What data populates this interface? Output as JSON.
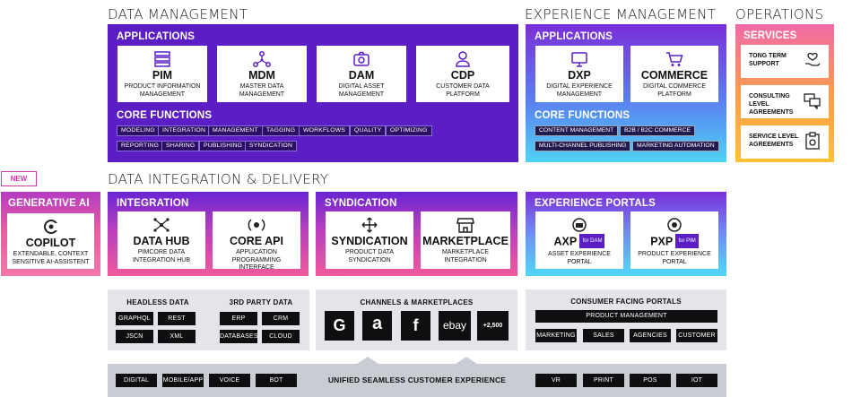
{
  "sections": {
    "data_management": "DATA MANAGEMENT",
    "experience_management": "EXPERIENCE MANAGEMENT",
    "operations": "OPERATIONS",
    "data_integration": "DATA INTEGRATION & DELIVERY"
  },
  "new_badge": "NEW",
  "dm": {
    "applications": "APPLICATIONS",
    "core_functions": "CORE FUNCTIONS",
    "apps": [
      {
        "title": "PIM",
        "sub": "PRODUCT INFORMATION MANAGEMENT",
        "icon": "server-stack-icon"
      },
      {
        "title": "MDM",
        "sub": "MASTER DATA MANAGEMENT",
        "icon": "network-icon"
      },
      {
        "title": "DAM",
        "sub": "DIGITAL ASSET MANAGEMENT",
        "icon": "camera-icon"
      },
      {
        "title": "CDP",
        "sub": "CUSTOMER DATA PLATFORM",
        "icon": "user-icon"
      }
    ],
    "functions": [
      "MODELING",
      "INTEGRATION",
      "MANAGEMENT",
      "TAGGING",
      "WORKFLOWS",
      "QUALITY",
      "OPTIMIZING",
      "REPORTING",
      "SHARING",
      "PUBLISHING",
      "SYNDICATION"
    ]
  },
  "xm": {
    "applications": "APPLICATIONS",
    "core_functions": "CORE FUNCTIONS",
    "apps": [
      {
        "title": "DXP",
        "sub": "DIGITAL EXPERIENCE MANAGEMENT",
        "icon": "monitor-icon"
      },
      {
        "title": "COMMERCE",
        "sub": "DIGITAL COMMERCE PLATFORM",
        "icon": "cart-icon"
      }
    ],
    "functions": [
      "CONTENT MANAGEMENT",
      "B2B / B2C COMMERCE",
      "MULTI-CHANNEL PUBLISHING",
      "MARKETING AUTOMATION"
    ]
  },
  "ops": {
    "services": "SERVICES",
    "cards": [
      {
        "label": "TONG TERM SUPPORT",
        "icon": "hand-heart-icon"
      },
      {
        "label": "CONSULTING LEVEL AGREEMENTS",
        "icon": "chat-icon"
      },
      {
        "label": "SERVICE LEVEL AGREEMENTS",
        "icon": "clipboard-icon"
      }
    ]
  },
  "genai": {
    "heading": "GENERATIVE AI",
    "title": "COPILOT",
    "sub": "EXTENDABLE, CONTEXT SENSITIVE AI-ASSISTENT"
  },
  "integration": {
    "heading": "INTEGRATION",
    "cards": [
      {
        "title": "DATA HUB",
        "sub": "PIMCORE DATA INTEGRATION HUB"
      },
      {
        "title": "CORE API",
        "sub": "APPLICATION PROGRAMMING INTERFACE"
      }
    ]
  },
  "syndication": {
    "heading": "SYNDICATION",
    "cards": [
      {
        "title": "SYNDICATION",
        "sub": "PRODUCT DATA SYNDICATION"
      },
      {
        "title": "MARKETPLACE",
        "sub": "MARKETPLACE INTEGRATION"
      }
    ]
  },
  "portals": {
    "heading": "EXPERIENCE PORTALS",
    "cards": [
      {
        "title": "AXP",
        "badge": "for DAM",
        "sub": "ASSET EXPERIENCE PORTAL"
      },
      {
        "title": "PXP",
        "badge": "for PIM",
        "sub": "PRODUCT EXPERIENCE PORTAL"
      }
    ]
  },
  "headless": {
    "heading": "HEADLESS DATA",
    "items": [
      "GRAPHQL",
      "REST",
      "JSCN",
      "XML"
    ]
  },
  "third_party": {
    "heading": "3RD PARTY DATA",
    "items": [
      "ERP",
      "CRM",
      "DATABASES",
      "CLOUD"
    ]
  },
  "channels": {
    "heading": "CHANNELS & MARKETPLACES",
    "items": [
      "G",
      "a",
      "f",
      "ebay",
      "+2,500"
    ]
  },
  "consumer": {
    "heading": "CONSUMER FACING PORTALS",
    "wide": "PRODUCT MANAGEMENT",
    "items": [
      "MARKETING",
      "SALES",
      "AGENCIES",
      "CUSTOMER"
    ]
  },
  "bottom": {
    "label": "UNIFIED SEAMLESS CUSTOMER EXPERIENCE",
    "left": [
      "DIGITAL",
      "MOBILE/APP",
      "VOICE",
      "BOT"
    ],
    "right": [
      "VR",
      "PRINT",
      "POS",
      "IOT"
    ]
  }
}
